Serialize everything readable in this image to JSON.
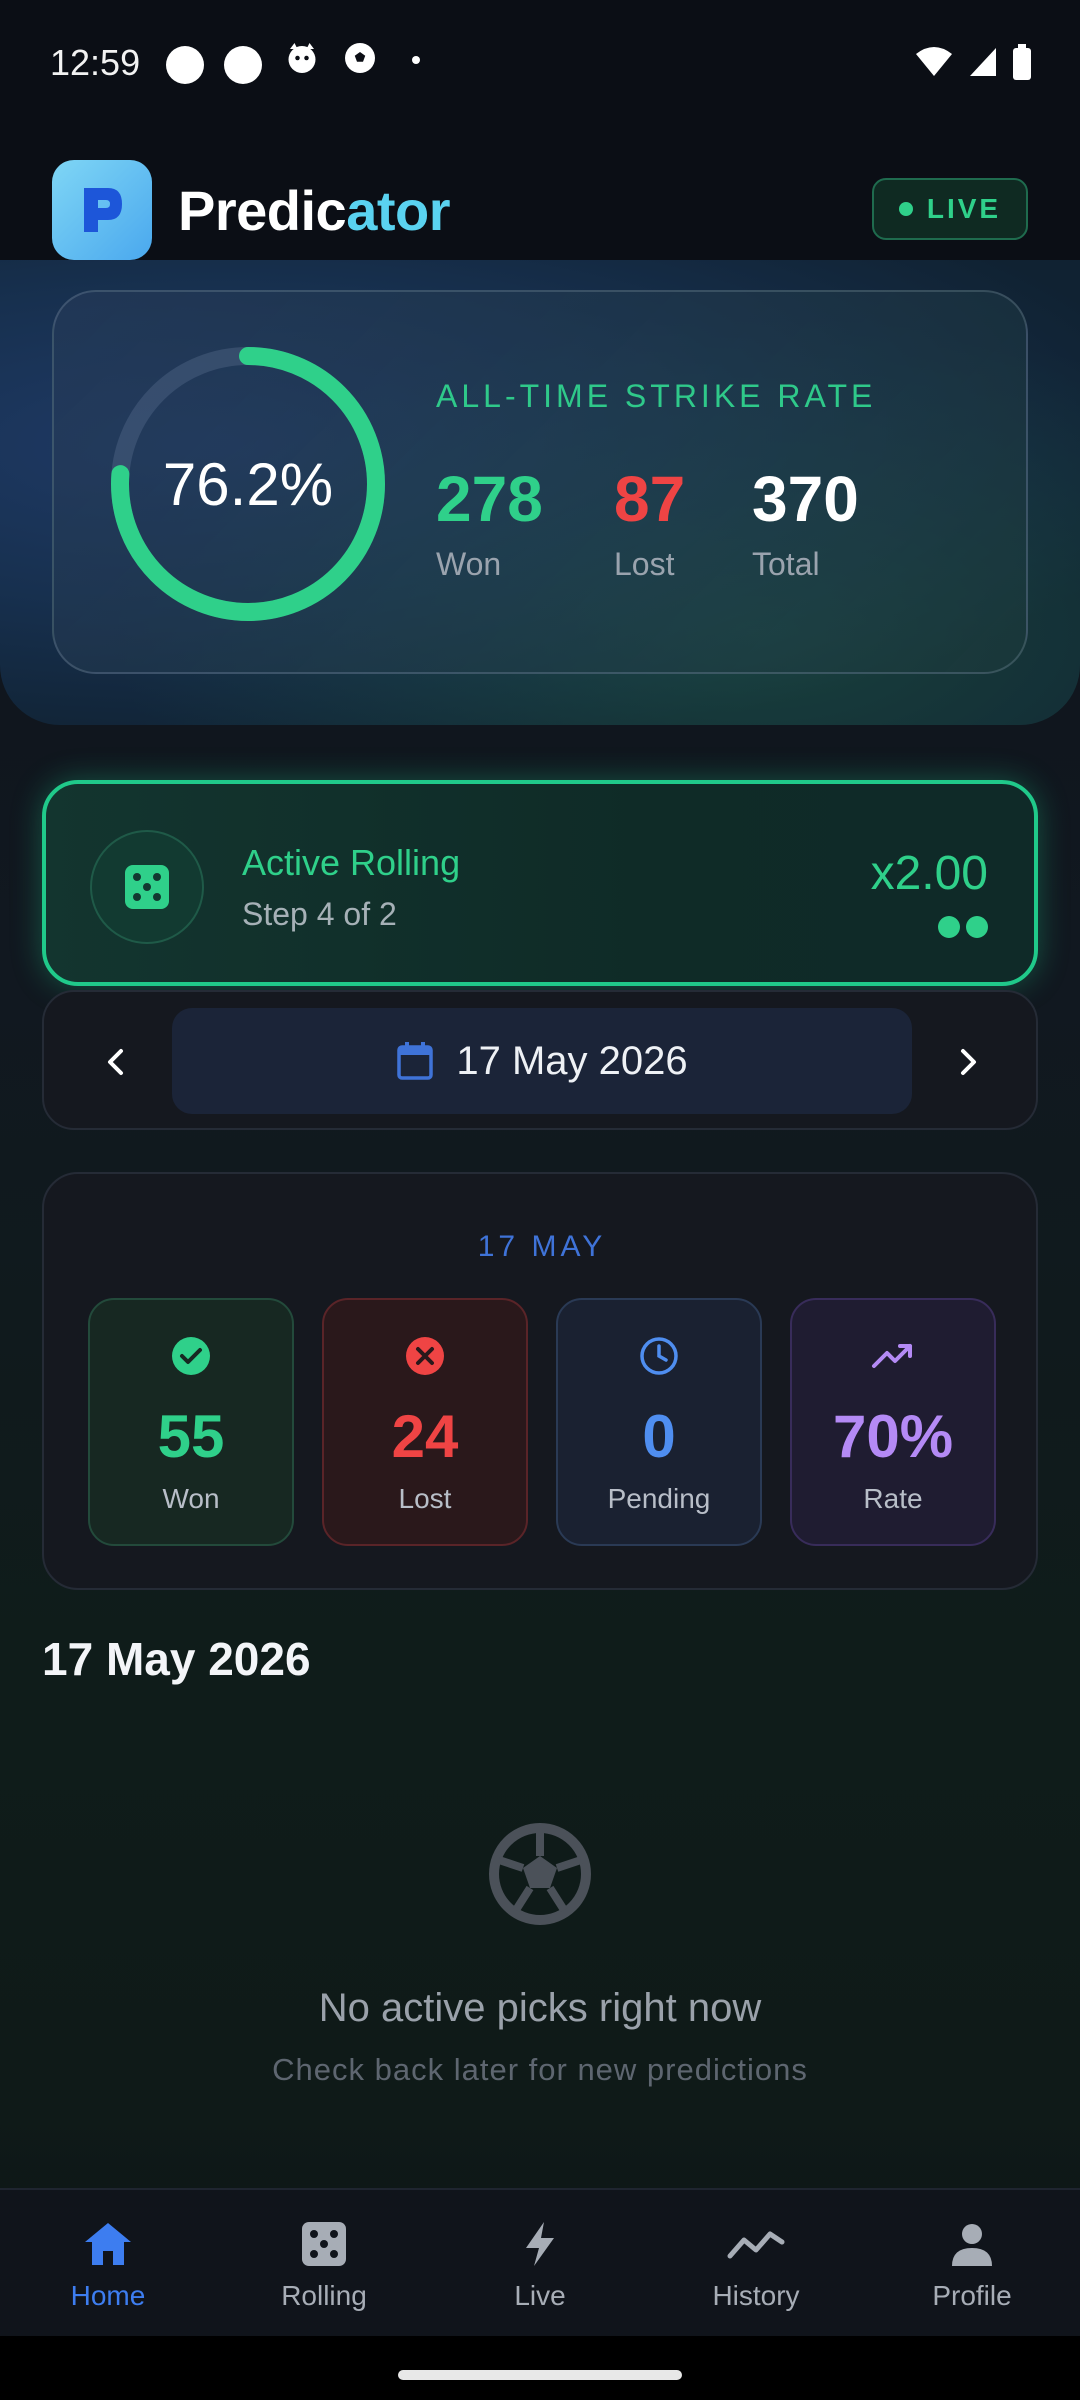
{
  "status_bar": {
    "time": "12:59"
  },
  "header": {
    "title_part1": "Predic",
    "title_part2": "ator",
    "live_label": "LIVE"
  },
  "strike_rate": {
    "percent_text": "76.2%",
    "percent_value": 76.2,
    "label": "ALL-TIME STRIKE RATE",
    "won": "278",
    "won_label": "Won",
    "lost": "87",
    "lost_label": "Lost",
    "total": "370",
    "total_label": "Total"
  },
  "rolling": {
    "title": "Active Rolling",
    "subtitle": "Step 4 of 2",
    "multiplier": "x2.00"
  },
  "date_nav": {
    "date": "17 May 2026"
  },
  "day_summary": {
    "label": "17 MAY",
    "tiles": [
      {
        "value": "55",
        "label": "Won",
        "icon": "check-circle-icon",
        "color": "#2fd08a"
      },
      {
        "value": "24",
        "label": "Lost",
        "icon": "x-circle-icon",
        "color": "#ef4444"
      },
      {
        "value": "0",
        "label": "Pending",
        "icon": "clock-icon",
        "color": "#4f8ef0"
      },
      {
        "value": "70%",
        "label": "Rate",
        "icon": "trending-up-icon",
        "color": "#b48af5"
      }
    ]
  },
  "section": {
    "title": "17 May 2026"
  },
  "empty_state": {
    "title": "No active picks right now",
    "subtitle": "Check back later for new predictions",
    "icon": "soccer-ball-icon"
  },
  "bottom_nav": {
    "items": [
      {
        "label": "Home",
        "icon": "home-icon"
      },
      {
        "label": "Rolling",
        "icon": "dice-icon"
      },
      {
        "label": "Live",
        "icon": "bolt-icon"
      },
      {
        "label": "History",
        "icon": "chart-line-icon"
      },
      {
        "label": "Profile",
        "icon": "person-icon"
      }
    ],
    "active": "Home"
  },
  "colors": {
    "accent_green": "#2fd08a",
    "accent_blue": "#3d7df0",
    "lost_red": "#ef4444",
    "rate_purple": "#b48af5"
  }
}
